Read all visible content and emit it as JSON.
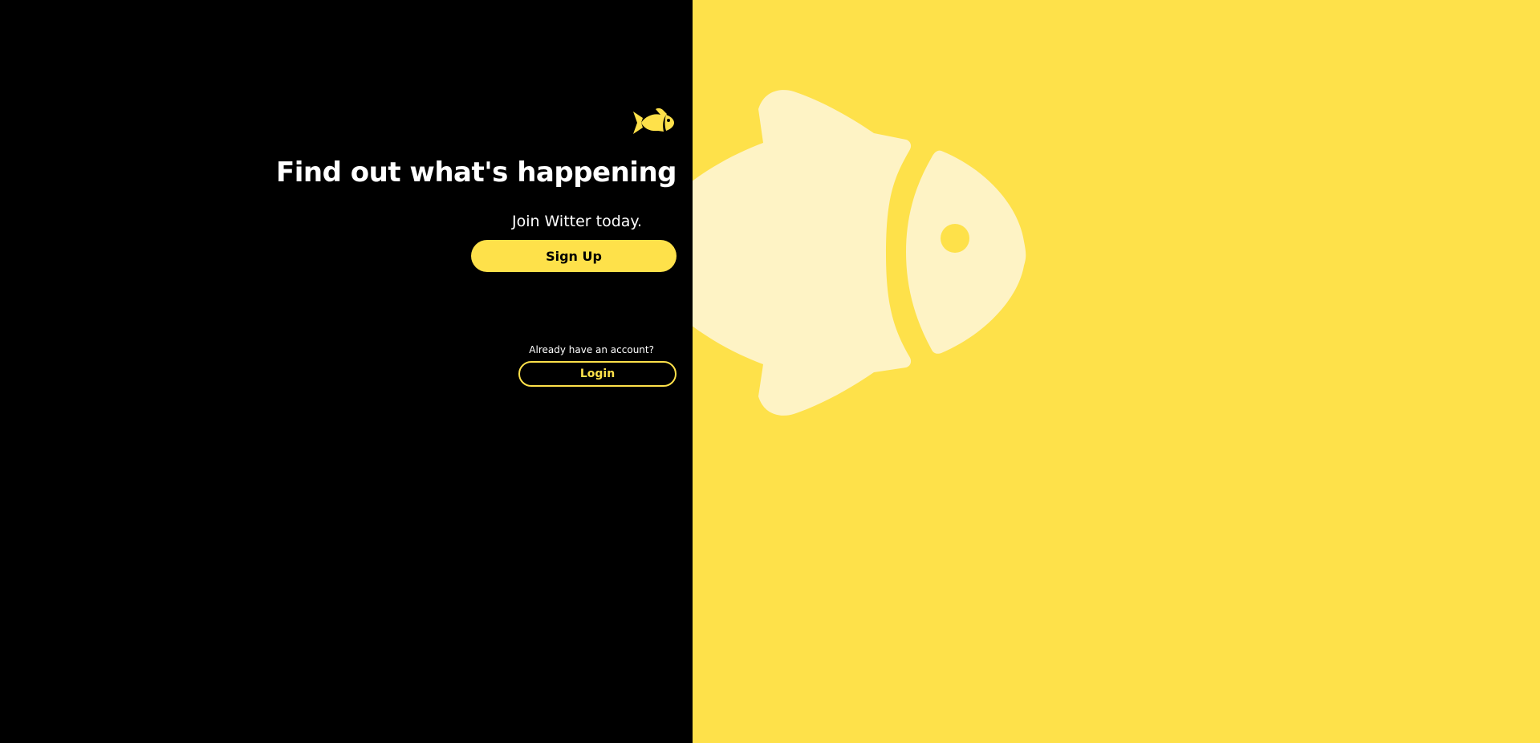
{
  "brand": {
    "logo_icon": "fish-icon",
    "accent_color": "#FEE14A",
    "background_dark": "#000000"
  },
  "hero": {
    "headline": "Find out what's happening",
    "subtitle": "Join Witter today.",
    "signup_label": "Sign Up"
  },
  "login": {
    "prompt": "Already have an account?",
    "login_label": "Login"
  },
  "illustration": {
    "icon": "fish-icon",
    "tint": "#FEF3C5"
  }
}
